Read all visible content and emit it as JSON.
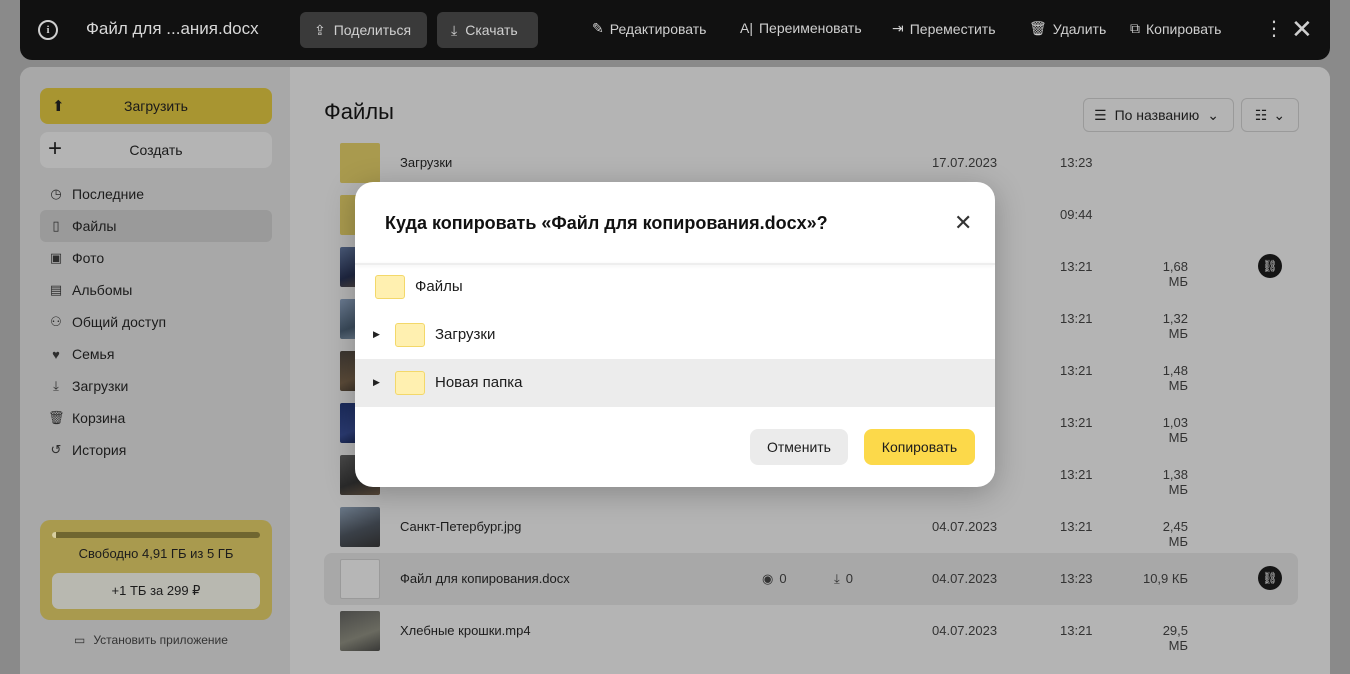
{
  "topbar": {
    "title": "Файл для ...ания.docx",
    "share_label": "Поделиться",
    "download_label": "Скачать",
    "edit_label": "Редактировать",
    "rename_label": "Переименовать",
    "move_label": "Переместить",
    "delete_label": "Удалить",
    "copy_label": "Копировать"
  },
  "sidebar": {
    "upload_label": "Загрузить",
    "create_label": "Создать",
    "items": [
      {
        "label": "Последние",
        "icon": "clock-icon"
      },
      {
        "label": "Файлы",
        "icon": "file-icon"
      },
      {
        "label": "Фото",
        "icon": "photo-icon"
      },
      {
        "label": "Альбомы",
        "icon": "album-icon"
      },
      {
        "label": "Общий доступ",
        "icon": "shared-icon"
      },
      {
        "label": "Семья",
        "icon": "family-icon"
      },
      {
        "label": "Загрузки",
        "icon": "download-icon"
      },
      {
        "label": "Корзина",
        "icon": "trash-icon"
      },
      {
        "label": "История",
        "icon": "history-icon"
      }
    ],
    "storage": {
      "free_text": "Свободно 4,91 ГБ из 5 ГБ",
      "used_fraction": 0.018,
      "promo_label": "+1 ТБ за 299 ₽"
    },
    "install_label": "Установить приложение"
  },
  "main": {
    "title": "Файлы",
    "sort_label": "По названию",
    "files": [
      {
        "name": "Загрузки",
        "date": "17.07.2023",
        "time": "13:23",
        "size": ""
      },
      {
        "name": "",
        "date": "",
        "time": "09:44",
        "size": ""
      },
      {
        "name": "",
        "date": "",
        "time": "13:21",
        "size": "1,68 МБ"
      },
      {
        "name": "",
        "date": "",
        "time": "13:21",
        "size": "1,32 МБ"
      },
      {
        "name": "",
        "date": "",
        "time": "13:21",
        "size": "1,48 МБ"
      },
      {
        "name": "",
        "date": "",
        "time": "13:21",
        "size": "1,03 МБ"
      },
      {
        "name": "",
        "date": "",
        "time": "13:21",
        "size": "1,38 МБ"
      },
      {
        "name": "Санкт-Петербург.jpg",
        "date": "04.07.2023",
        "time": "13:21",
        "size": "2,45 МБ"
      },
      {
        "name": "Файл для копирования.docx",
        "date": "04.07.2023",
        "time": "13:23",
        "size": "10,9 КБ",
        "views": "0",
        "downloads": "0"
      },
      {
        "name": "Хлебные крошки.mp4",
        "date": "04.07.2023",
        "time": "13:21",
        "size": "29,5 МБ"
      }
    ]
  },
  "dialog": {
    "title": "Куда копировать «Файл для копирования.docx»?",
    "root_label": "Файлы",
    "folders": [
      {
        "label": "Загрузки"
      },
      {
        "label": "Новая папка"
      }
    ],
    "cancel_label": "Отменить",
    "confirm_label": "Копировать"
  },
  "colors": {
    "accent": "#fcd94a",
    "folder": "#fff0b0",
    "topbar_bg": "#111111"
  }
}
